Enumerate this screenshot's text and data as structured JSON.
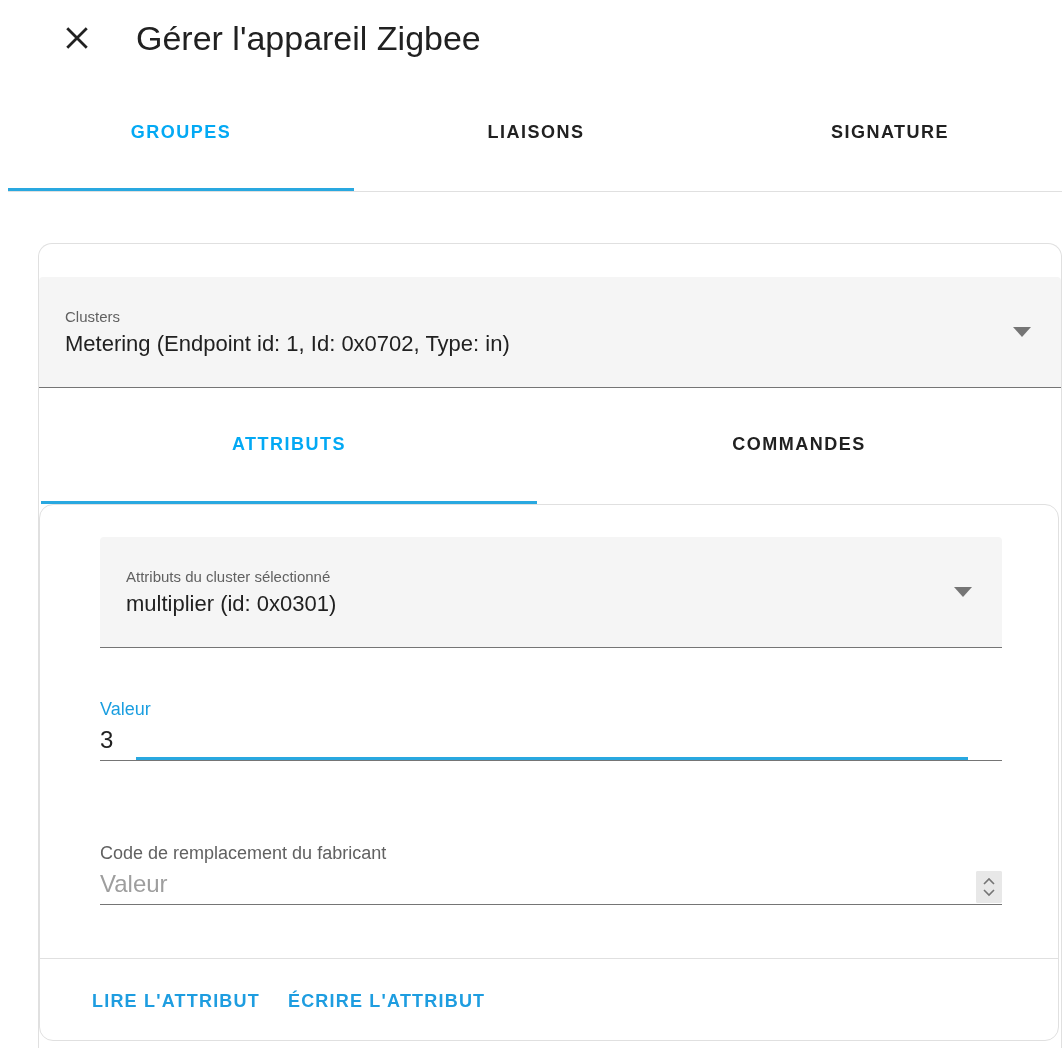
{
  "dialog": {
    "title": "Gérer l'appareil Zigbee"
  },
  "tabs": [
    {
      "label": "GROUPES",
      "selected": true
    },
    {
      "label": "LIAISONS",
      "selected": false
    },
    {
      "label": "SIGNATURE",
      "selected": false
    }
  ],
  "clusters_select": {
    "label": "Clusters",
    "value": "Metering (Endpoint id: 1, Id: 0x0702, Type: in)"
  },
  "cluster_tabs": [
    {
      "label": "ATTRIBUTS",
      "selected": true
    },
    {
      "label": "COMMANDES",
      "selected": false
    }
  ],
  "attribute_select": {
    "label": "Attributs du cluster sélectionné",
    "value": "multiplier (id: 0x0301)"
  },
  "value_field": {
    "label": "Valeur",
    "value": "3",
    "focused": true
  },
  "manufacturer_field": {
    "label": "Code de remplacement du fabricant",
    "placeholder": "Valeur",
    "focused": false
  },
  "actions": [
    "LIRE L'ATTRIBUT",
    "ÉCRIRE L'ATTRIBUT"
  ]
}
